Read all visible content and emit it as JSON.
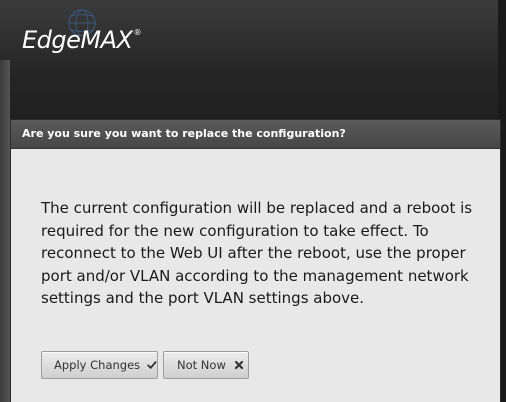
{
  "header": {
    "logo_text": "EdgeMAX",
    "logo_mark": "®"
  },
  "dialog": {
    "title": "Are you sure you want to replace the configuration?",
    "message": "The current configuration will be replaced and a reboot is required for the new configuration to take effect. To reconnect to the Web UI after the reboot, use the proper port and/or VLAN according to the management network settings and the port VLAN settings above.",
    "buttons": {
      "apply_label": "Apply Changes",
      "apply_icon": "checkmark-icon",
      "not_now_label": "Not Now",
      "not_now_icon": "close-icon"
    }
  },
  "colors": {
    "header_background": "#262626",
    "dialog_titlebar": "#505050",
    "dialog_background": "#e8e8e8",
    "button_background": "#dcdcdc"
  }
}
